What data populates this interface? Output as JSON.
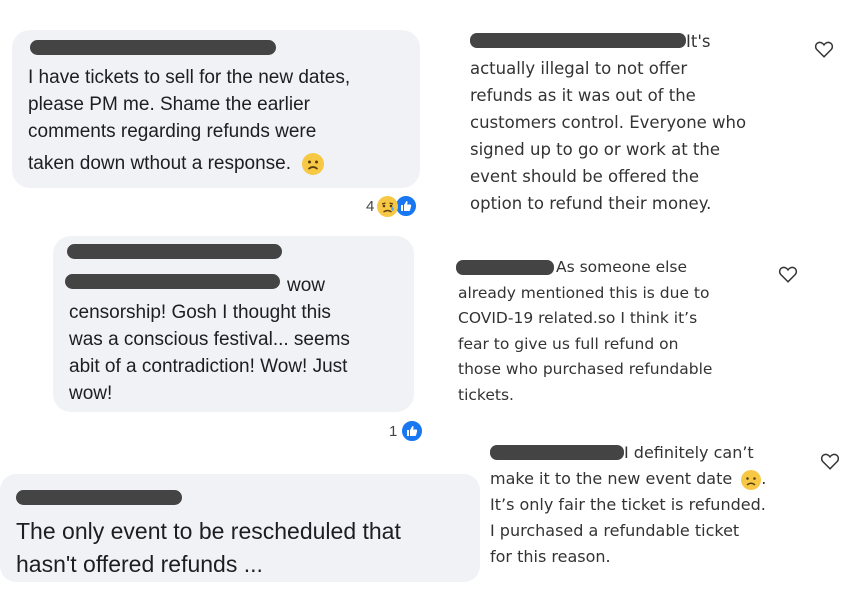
{
  "comments_left": [
    {
      "lines": [
        "I have tickets to sell for the new dates,",
        "please PM me. Shame the earlier",
        "comments regarding refunds were",
        "taken down wthout a response."
      ],
      "reaction_count": "4",
      "reaction_icons": [
        "sad-face-icon",
        "thumbs-up-icon"
      ]
    },
    {
      "lines": [
        "wow",
        "censorship! Gosh I thought this",
        "was a conscious festival... seems",
        "abit of a contradiction! Wow! Just",
        "wow!"
      ],
      "reaction_count": "1",
      "reaction_icons": [
        "thumbs-up-icon"
      ]
    },
    {
      "lines": [
        "The only event to be rescheduled that",
        "hasn't offered refunds ..."
      ]
    }
  ],
  "comments_right": [
    {
      "lines": [
        "It's",
        "actually illegal to not offer",
        "refunds as it was out of the",
        "customers control. Everyone who",
        "signed up to go or work at the",
        "event should be offered the",
        "option to refund their money."
      ]
    },
    {
      "lines": [
        "As someone else",
        "already mentioned this is due to",
        "COVID-19 related.so I think it’s",
        "fear to give us full refund on",
        "those who purchased refundable",
        "tickets."
      ]
    },
    {
      "lines": [
        "I definitely can’t",
        "make it to the new event date",
        ".",
        "It’s only fair the ticket is refunded.",
        "I purchased a refundable ticket",
        "for this reason."
      ]
    }
  ],
  "colors": {
    "bubble": "#f0f2f5",
    "redaction": "#444444",
    "like_blue": "#1877f2",
    "emoji_yellow": "#f7c844"
  }
}
